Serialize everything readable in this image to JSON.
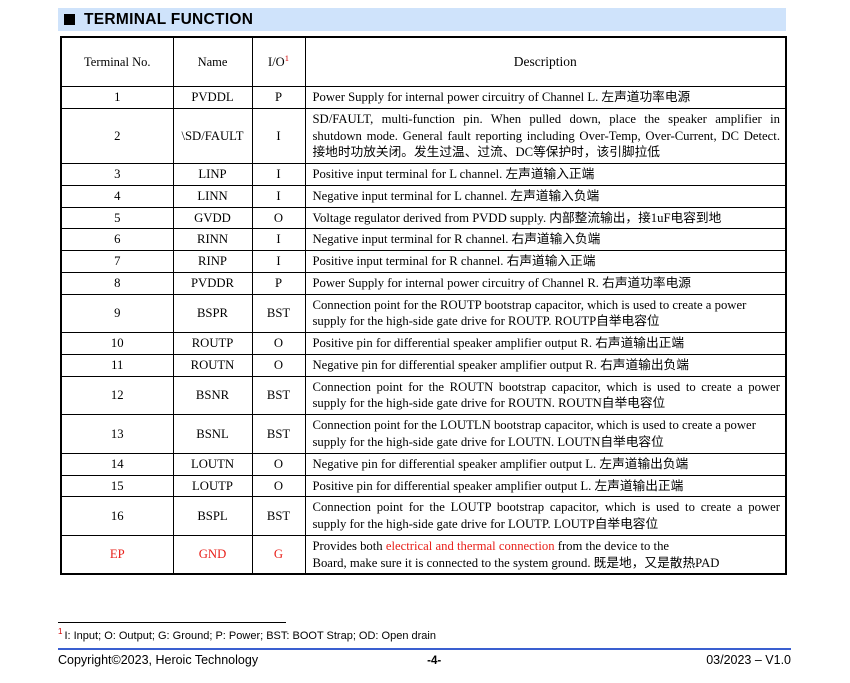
{
  "section": {
    "bullet": "filled-square-bullet",
    "title": "TERMINAL FUNCTION"
  },
  "table": {
    "headers": {
      "terminal_no": "Terminal No.",
      "name": "Name",
      "io": "I/O",
      "io_footnote_mark": "1",
      "description": "Description"
    },
    "rows": [
      {
        "no": "1",
        "name": "PVDDL",
        "io": "P",
        "desc": "Power Supply for internal power circuitry of Channel L. 左声道功率电源",
        "justify": false,
        "red": false
      },
      {
        "no": "2",
        "name": "\\SD/FAULT",
        "io": "I",
        "desc": "SD/FAULT, multi-function pin. When pulled down, place the speaker amplifier in shutdown mode. General fault reporting including Over-Temp, Over-Current, DC Detect. 接地时功放关闭。发生过温、过流、DC等保护时，该引脚拉低",
        "justify": true,
        "red": false
      },
      {
        "no": "3",
        "name": "LINP",
        "io": "I",
        "desc": "Positive input terminal for L channel. 左声道输入正端",
        "justify": false,
        "red": false
      },
      {
        "no": "4",
        "name": "LINN",
        "io": "I",
        "desc": "Negative input terminal for L channel. 左声道输入负端",
        "justify": false,
        "red": false
      },
      {
        "no": "5",
        "name": "GVDD",
        "io": "O",
        "desc": "Voltage regulator derived from PVDD supply. 内部整流输出，接1uF电容到地",
        "justify": false,
        "red": false
      },
      {
        "no": "6",
        "name": "RINN",
        "io": "I",
        "desc": "Negative input terminal for R channel. 右声道输入负端",
        "justify": false,
        "red": false
      },
      {
        "no": "7",
        "name": "RINP",
        "io": "I",
        "desc": "Positive input terminal for R channel. 右声道输入正端",
        "justify": false,
        "red": false
      },
      {
        "no": "8",
        "name": "PVDDR",
        "io": "P",
        "desc": "Power Supply for internal power circuitry of Channel R. 右声道功率电源",
        "justify": false,
        "red": false
      },
      {
        "no": "9",
        "name": "BSPR",
        "io": "BST",
        "desc": "Connection point for the ROUTP bootstrap capacitor, which is used to create a power supply for the high-side gate drive for ROUTP. ROUTP自举电容位",
        "justify": false,
        "red": false
      },
      {
        "no": "10",
        "name": "ROUTP",
        "io": "O",
        "desc": "Positive pin for differential speaker amplifier output R. 右声道输出正端",
        "justify": false,
        "red": false
      },
      {
        "no": "11",
        "name": "ROUTN",
        "io": "O",
        "desc": "Negative pin for differential speaker amplifier output R. 右声道输出负端",
        "justify": false,
        "red": false
      },
      {
        "no": "12",
        "name": "BSNR",
        "io": "BST",
        "desc": "Connection point for the ROUTN bootstrap capacitor, which is used to create a power supply for the high-side gate drive for ROUTN. ROUTN自举电容位",
        "justify": true,
        "red": false
      },
      {
        "no": "13",
        "name": "BSNL",
        "io": "BST",
        "desc": "Connection point for the LOUTLN bootstrap capacitor, which is used to create a power supply for the high-side gate drive for LOUTN. LOUTN自举电容位",
        "justify": false,
        "red": false
      },
      {
        "no": "14",
        "name": "LOUTN",
        "io": "O",
        "desc": "Negative pin for differential speaker amplifier output L. 左声道输出负端",
        "justify": false,
        "red": false
      },
      {
        "no": "15",
        "name": "LOUTP",
        "io": "O",
        "desc": "Positive pin for differential speaker amplifier output L. 左声道输出正端",
        "justify": false,
        "red": false
      },
      {
        "no": "16",
        "name": "BSPL",
        "io": "BST",
        "desc": "Connection point for the LOUTP bootstrap capacitor, which is used to create a power supply for the high-side gate drive for LOUTP. LOUTP自举电容位",
        "justify": true,
        "red": false
      }
    ],
    "ep_row": {
      "no": "EP",
      "name": "GND",
      "io": "G",
      "desc_part1": "Provides both ",
      "desc_highlight": "electrical and thermal connection",
      "desc_part2": " from the device to the",
      "desc_line2": "Board, make sure it is connected to the system ground. 既是地，又是散热PAD",
      "red": true
    }
  },
  "footnote": {
    "mark": "1",
    "text": "I: Input; O: Output; G: Ground; P: Power; BST: BOOT Strap; OD: Open drain"
  },
  "footer": {
    "copyright": "Copyright©2023, Heroic Technology",
    "page": "-4-",
    "revision": "03/2023 – V1.0"
  },
  "colors": {
    "banner_blue": "#cfe3fb",
    "accent_red": "#e8201a",
    "footer_rule_blue": "#3a5fd0",
    "text_black": "#000000"
  }
}
